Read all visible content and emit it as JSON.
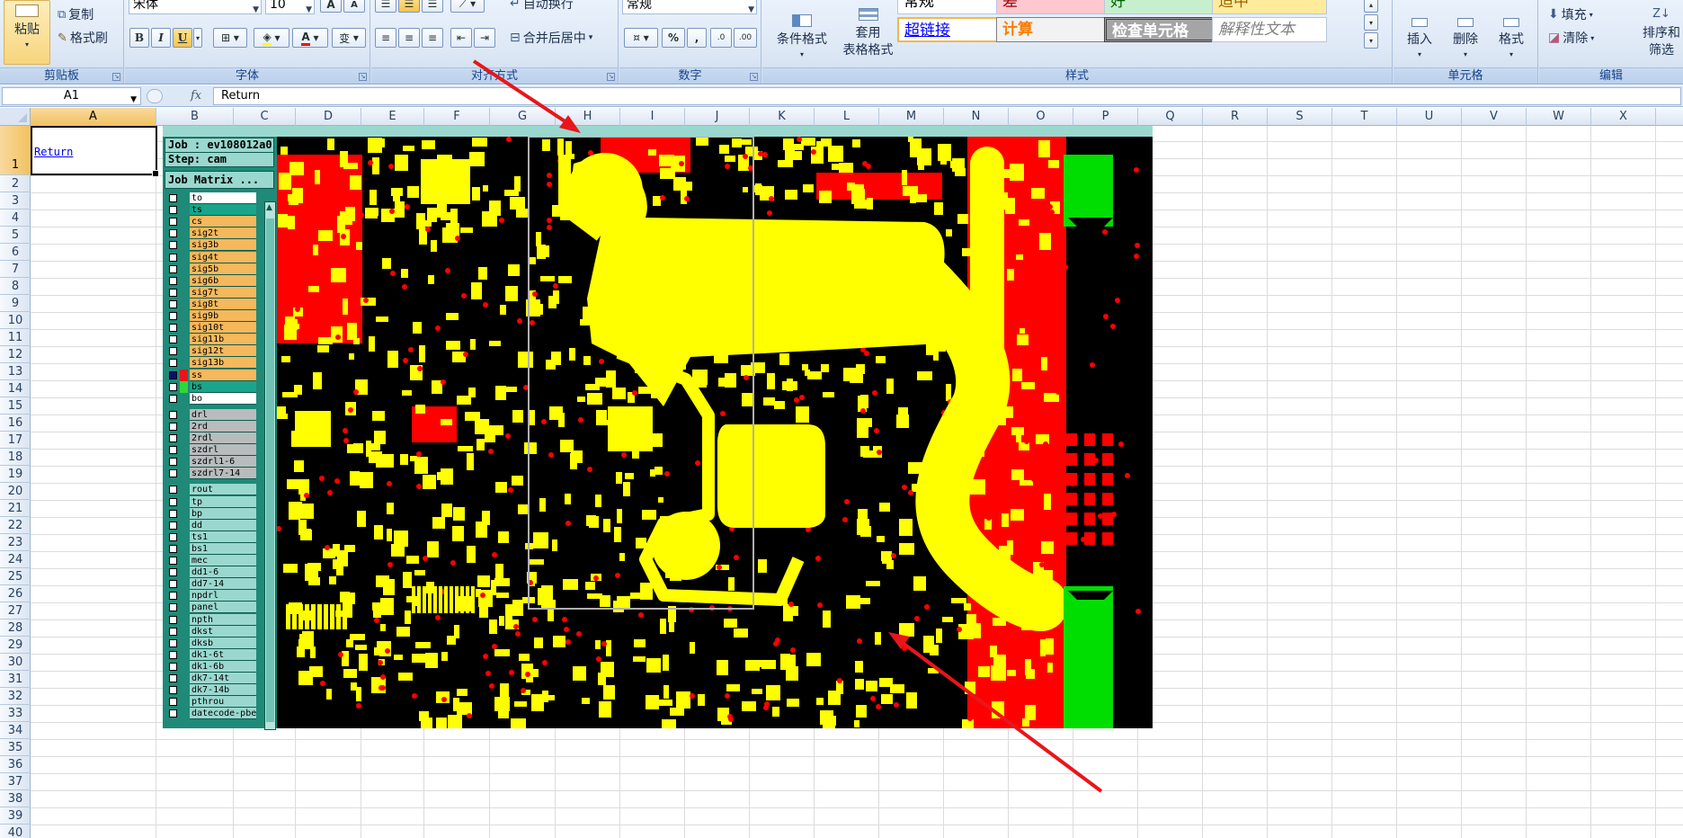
{
  "ribbon": {
    "clipboard": {
      "paste": "粘贴",
      "copy": "复制",
      "format_painter": "格式刷",
      "label": "剪贴板"
    },
    "font": {
      "name": "宋体",
      "size": "10",
      "grow": "A",
      "shrink": "A",
      "bold": "B",
      "italic": "I",
      "underline": "U",
      "phonetic": "变",
      "label": "字体"
    },
    "alignment": {
      "wrap_text": "自动换行",
      "merge_center": "合并后居中",
      "label": "对齐方式"
    },
    "number": {
      "format": "常规",
      "percent": "%",
      "comma": ",",
      "inc_decimal": ".0",
      "dec_decimal": ".00",
      "label": "数字"
    },
    "styles": {
      "cond_format": "条件格式",
      "table_format_1": "套用",
      "table_format_2": "表格格式",
      "cells": [
        {
          "text": "常规",
          "bg": "#ffffff",
          "fg": "#000000"
        },
        {
          "text": "差",
          "bg": "#ffc7ce",
          "fg": "#9c0006"
        },
        {
          "text": "好",
          "bg": "#c6efce",
          "fg": "#006100"
        },
        {
          "text": "适中",
          "bg": "#ffeb9c",
          "fg": "#9c6500"
        },
        {
          "text": "超链接",
          "bg": "#ffffff",
          "fg": "#0000ff"
        },
        {
          "text": "计算",
          "bg": "#f2f2f2",
          "fg": "#fa7d00"
        },
        {
          "text": "检查单元格",
          "bg": "#a5a5a5",
          "fg": "#ffffff"
        },
        {
          "text": "解释性文本",
          "bg": "#ffffff",
          "fg": "#7f7f7f"
        }
      ],
      "label": "样式"
    },
    "cells": {
      "insert": "插入",
      "delete": "删除",
      "format": "格式",
      "label": "单元格"
    },
    "editing": {
      "fill": "填充",
      "clear": "清除",
      "sort_1": "排序和",
      "sort_2": "筛选",
      "label": "编辑"
    }
  },
  "formula_bar": {
    "name_box": "A1",
    "fx": "fx",
    "content": "Return"
  },
  "columns": [
    "A",
    "B",
    "C",
    "D",
    "E",
    "F",
    "G",
    "H",
    "I",
    "J",
    "K",
    "L",
    "M",
    "N",
    "O",
    "P",
    "Q",
    "R",
    "S",
    "T",
    "U",
    "V",
    "W",
    "X"
  ],
  "rows": [
    "1",
    "2",
    "3",
    "4",
    "5",
    "6",
    "7",
    "8",
    "9",
    "10",
    "11",
    "12",
    "13",
    "14",
    "15",
    "16",
    "17",
    "18",
    "19",
    "20",
    "21",
    "22",
    "23",
    "24",
    "25",
    "26",
    "27",
    "28",
    "29",
    "30",
    "31",
    "32",
    "33",
    "34",
    "35",
    "36",
    "37",
    "38",
    "39",
    "40"
  ],
  "cell_a1": "Return",
  "genesis": {
    "job": "Job : ev108012a0",
    "step": "Step: cam",
    "matrix": "Job Matrix ...",
    "layers": [
      {
        "name": "to",
        "color": "#ffffff",
        "swatch": "#1f8a78",
        "checked": false
      },
      {
        "name": "ts",
        "color": "#1aa58a",
        "swatch": "#1f8a78",
        "checked": false
      },
      {
        "name": "cs",
        "color": "#f5b85c",
        "swatch": "#1f8a78",
        "checked": false
      },
      {
        "name": "sig2t",
        "color": "#f5b85c",
        "swatch": "#1f8a78",
        "checked": false
      },
      {
        "name": "sig3b",
        "color": "#f5b85c",
        "swatch": "#1f8a78",
        "checked": false
      },
      {
        "name": "sig4t",
        "color": "#f5b85c",
        "swatch": "#1f8a78",
        "checked": false
      },
      {
        "name": "sig5b",
        "color": "#f5b85c",
        "swatch": "#1f8a78",
        "checked": false
      },
      {
        "name": "sig6b",
        "color": "#f5b85c",
        "swatch": "#1f8a78",
        "checked": false
      },
      {
        "name": "sig7t",
        "color": "#f5b85c",
        "swatch": "#1f8a78",
        "checked": false
      },
      {
        "name": "sig8t",
        "color": "#f5b85c",
        "swatch": "#1f8a78",
        "checked": false
      },
      {
        "name": "sig9b",
        "color": "#f5b85c",
        "swatch": "#1f8a78",
        "checked": false
      },
      {
        "name": "sig10t",
        "color": "#f5b85c",
        "swatch": "#1f8a78",
        "checked": false
      },
      {
        "name": "sig11b",
        "color": "#f5b85c",
        "swatch": "#1f8a78",
        "checked": false
      },
      {
        "name": "sig12t",
        "color": "#f5b85c",
        "swatch": "#1f8a78",
        "checked": false
      },
      {
        "name": "sig13b",
        "color": "#f5b85c",
        "swatch": "#1f8a78",
        "checked": false
      },
      {
        "name": "ss",
        "color": "#f5b85c",
        "swatch": "#e8161b",
        "checked": true
      },
      {
        "name": "bs",
        "color": "#1aa58a",
        "swatch": "#2fd838",
        "checked": false
      },
      {
        "name": "bo",
        "color": "#ffffff",
        "swatch": "#1f8a78",
        "checked": false
      },
      {
        "name": "drl",
        "color": "#b8bcbd",
        "swatch": "#1f8a78",
        "checked": false
      },
      {
        "name": "2rd",
        "color": "#b8bcbd",
        "swatch": "#1f8a78",
        "checked": false
      },
      {
        "name": "2rdl",
        "color": "#b8bcbd",
        "swatch": "#1f8a78",
        "checked": false
      },
      {
        "name": "szdrl",
        "color": "#b8bcbd",
        "swatch": "#1f8a78",
        "checked": false
      },
      {
        "name": "szdrl1-6",
        "color": "#b8bcbd",
        "swatch": "#1f8a78",
        "checked": false
      },
      {
        "name": "szdrl7-14",
        "color": "#b8bcbd",
        "swatch": "#1f8a78",
        "checked": false
      },
      {
        "name": "rout",
        "color": "#9ad8cf",
        "swatch": "#1f8a78",
        "checked": false
      },
      {
        "name": "tp",
        "color": "#9ad8cf",
        "swatch": "#1f8a78",
        "checked": false
      },
      {
        "name": "bp",
        "color": "#9ad8cf",
        "swatch": "#1f8a78",
        "checked": false
      },
      {
        "name": "dd",
        "color": "#9ad8cf",
        "swatch": "#1f8a78",
        "checked": false
      },
      {
        "name": "ts1",
        "color": "#9ad8cf",
        "swatch": "#1f8a78",
        "checked": false
      },
      {
        "name": "bs1",
        "color": "#9ad8cf",
        "swatch": "#1f8a78",
        "checked": false
      },
      {
        "name": "mec",
        "color": "#9ad8cf",
        "swatch": "#1f8a78",
        "checked": false
      },
      {
        "name": "dd1-6",
        "color": "#9ad8cf",
        "swatch": "#1f8a78",
        "checked": false
      },
      {
        "name": "dd7-14",
        "color": "#9ad8cf",
        "swatch": "#1f8a78",
        "checked": false
      },
      {
        "name": "npdrl",
        "color": "#9ad8cf",
        "swatch": "#1f8a78",
        "checked": false
      },
      {
        "name": "panel",
        "color": "#9ad8cf",
        "swatch": "#1f8a78",
        "checked": false
      },
      {
        "name": "npth",
        "color": "#9ad8cf",
        "swatch": "#1f8a78",
        "checked": false
      },
      {
        "name": "dkst",
        "color": "#9ad8cf",
        "swatch": "#1f8a78",
        "checked": false
      },
      {
        "name": "dksb",
        "color": "#9ad8cf",
        "swatch": "#1f8a78",
        "checked": false
      },
      {
        "name": "dk1-6t",
        "color": "#9ad8cf",
        "swatch": "#1f8a78",
        "checked": false
      },
      {
        "name": "dk1-6b",
        "color": "#9ad8cf",
        "swatch": "#1f8a78",
        "checked": false
      },
      {
        "name": "dk7-14t",
        "color": "#9ad8cf",
        "swatch": "#1f8a78",
        "checked": false
      },
      {
        "name": "dk7-14b",
        "color": "#9ad8cf",
        "swatch": "#1f8a78",
        "checked": false
      },
      {
        "name": "pthrou",
        "color": "#9ad8cf",
        "swatch": "#1f8a78",
        "checked": false
      },
      {
        "name": "datecode-pbe",
        "color": "#9ad8cf",
        "swatch": "#1f8a78",
        "checked": false
      }
    ]
  },
  "colors": {
    "copper": "#ffff00",
    "mask": "#ff0000",
    "board": "#000000",
    "silk_green": "#00dd00",
    "annotation_arrow": "#e8161b"
  }
}
